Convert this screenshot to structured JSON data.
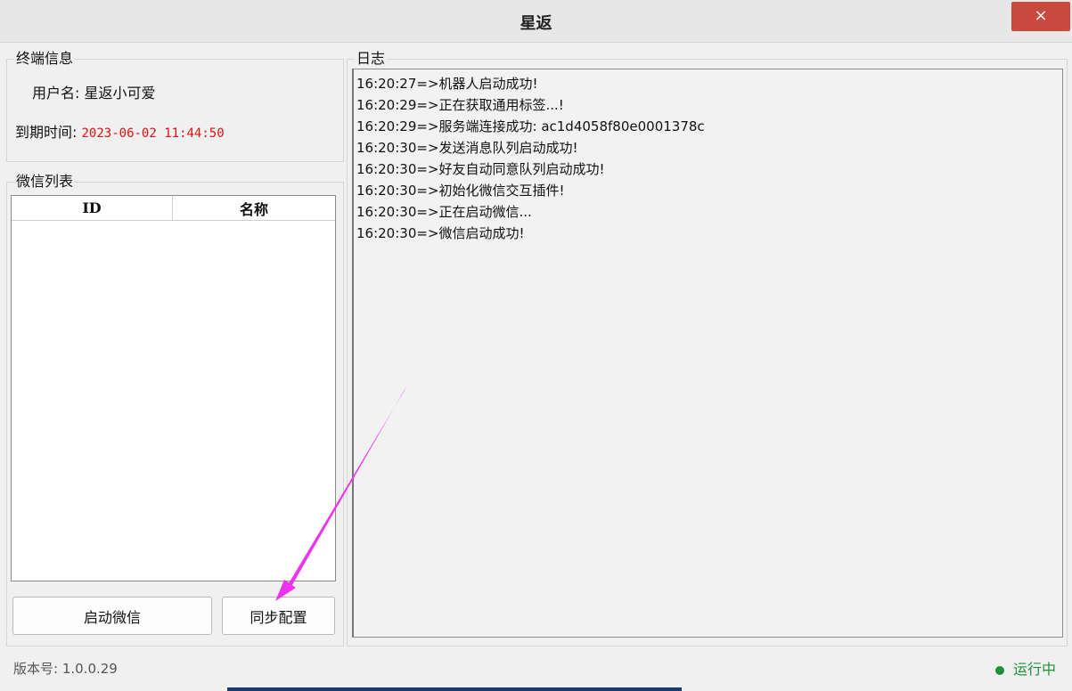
{
  "window": {
    "title": "星返",
    "close_glyph": "×"
  },
  "terminal_info": {
    "legend": "终端信息",
    "username_label": "用户名:",
    "username_value": "星返小可爱",
    "expiry_label": "到期时间:",
    "expiry_value": "2023-06-02 11:44:50"
  },
  "wechat_list": {
    "legend": "微信列表",
    "columns": [
      "ID",
      "名称"
    ],
    "rows": []
  },
  "buttons": {
    "start_wechat": "启动微信",
    "sync_config": "同步配置"
  },
  "log": {
    "legend": "日志",
    "lines": [
      "16:20:27=>机器人启动成功!",
      "16:20:29=>正在获取通用标签...!",
      "16:20:29=>服务端连接成功: ac1d4058f80e0001378c",
      "16:20:30=>发送消息队列启动成功!",
      "16:20:30=>好友自动同意队列启动成功!",
      "16:20:30=>初始化微信交互插件!",
      "16:20:30=>正在启动微信...",
      "16:20:30=>微信启动成功!"
    ]
  },
  "statusbar": {
    "version": "版本号: 1.0.0.29",
    "status": "运行中"
  },
  "colors": {
    "accent_close": "#c84a3e",
    "expiry_red": "#e01010",
    "status_green": "#1f8f3a",
    "annotation_arrow": "#ee33ee"
  }
}
